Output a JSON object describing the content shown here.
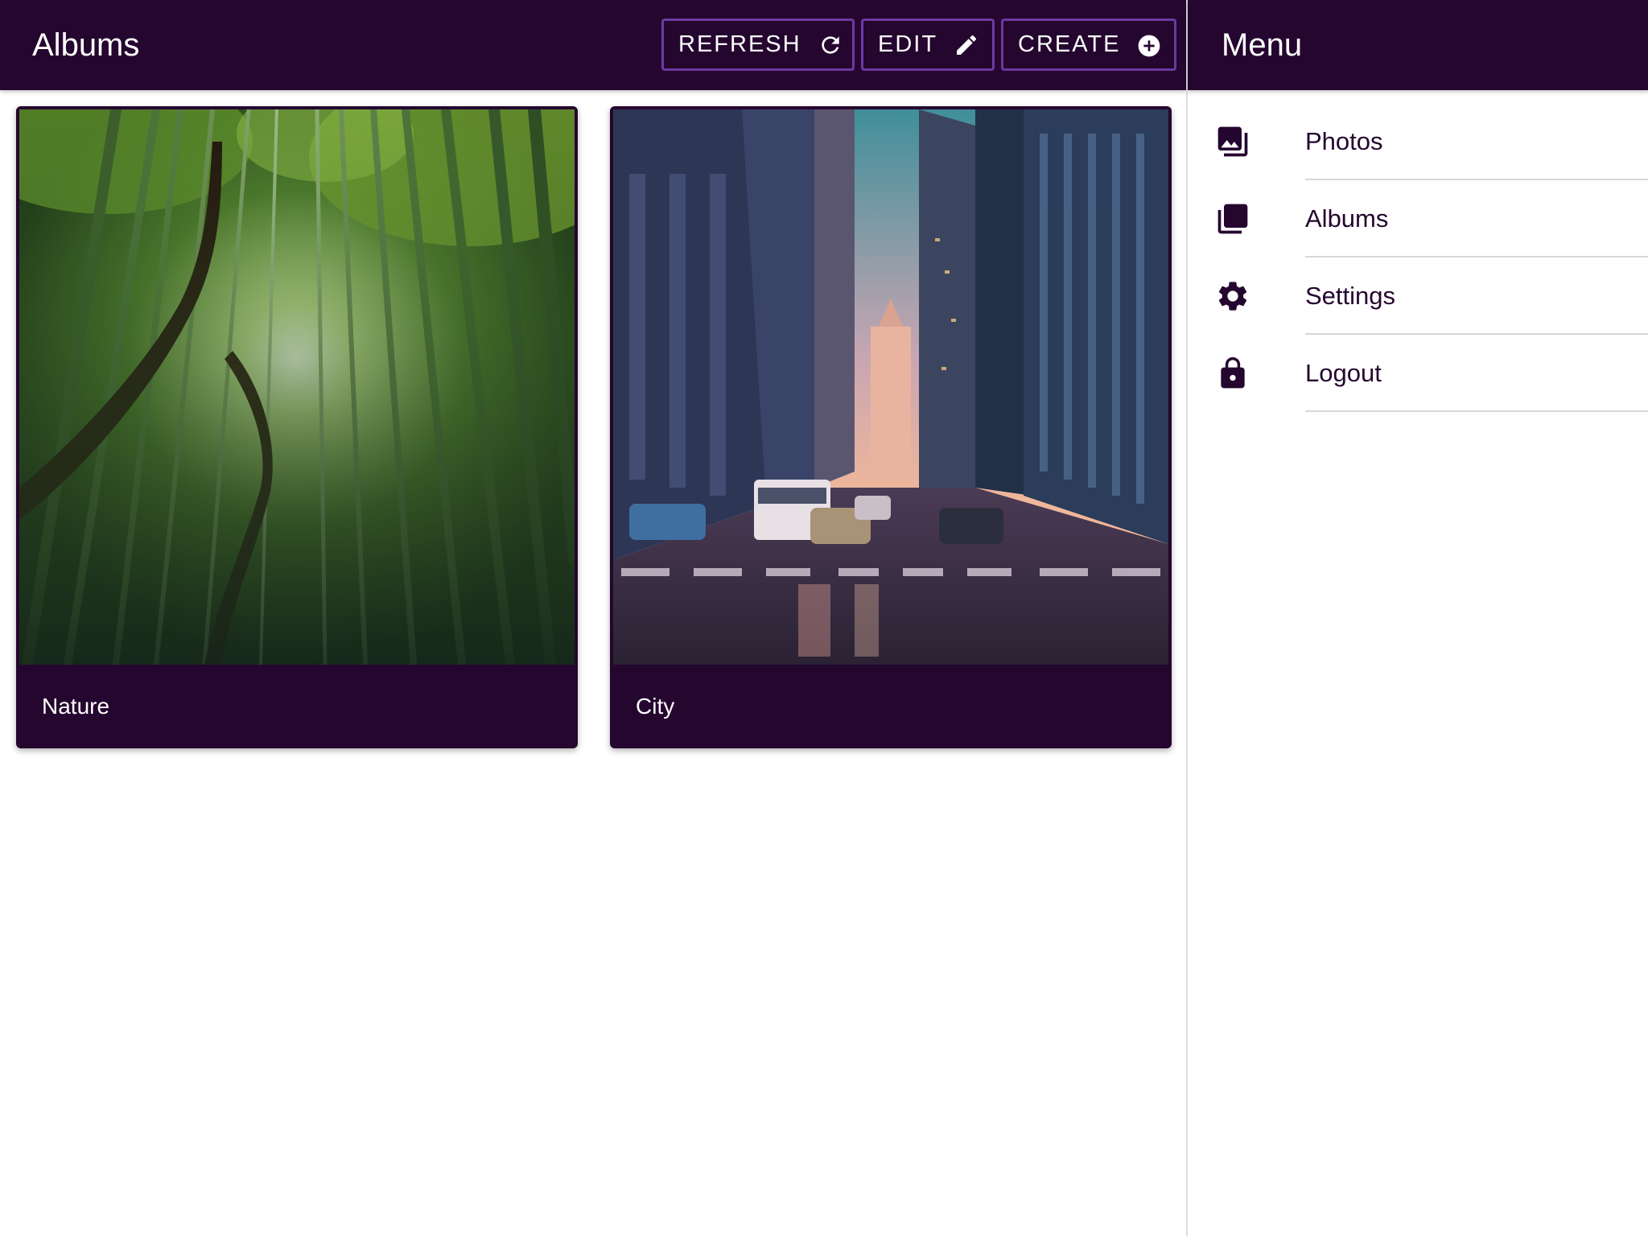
{
  "header": {
    "title": "Albums",
    "buttons": {
      "refresh_label": "REFRESH",
      "refresh_icon": "refresh-icon",
      "edit_label": "EDIT",
      "edit_icon": "pencil-icon",
      "create_label": "CREATE",
      "create_icon": "add-circle-icon"
    }
  },
  "albums": [
    {
      "title": "Nature",
      "image": "bamboo-forest-photo"
    },
    {
      "title": "City",
      "image": "city-street-photo"
    }
  ],
  "menu": {
    "title": "Menu",
    "items": [
      {
        "label": "Photos",
        "icon": "photo-library-icon"
      },
      {
        "label": "Albums",
        "icon": "albums-icon"
      },
      {
        "label": "Settings",
        "icon": "gear-icon"
      },
      {
        "label": "Logout",
        "icon": "lock-icon"
      }
    ]
  },
  "colors": {
    "primary": "#25062f",
    "button_border": "#6b3aa0",
    "text_on_primary": "#ffffff",
    "divider": "#d6d6d6"
  }
}
